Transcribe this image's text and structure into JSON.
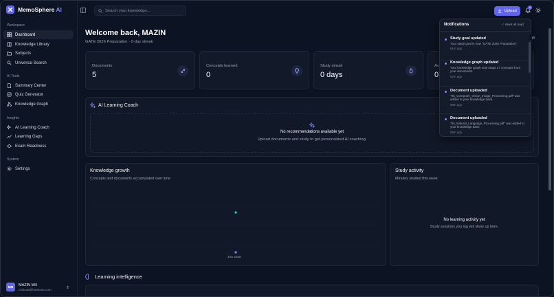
{
  "brand": {
    "name": "MemoSphere",
    "suffix": "AI"
  },
  "sidebar": {
    "sections": [
      {
        "title": "Workspace",
        "items": [
          {
            "label": "Dashboard",
            "icon": "grid-icon",
            "active": true
          },
          {
            "label": "Knowledge Library",
            "icon": "book-icon"
          },
          {
            "label": "Subjects",
            "icon": "folder-icon"
          },
          {
            "label": "Universal Search",
            "icon": "search-icon"
          }
        ]
      },
      {
        "title": "AI Tools",
        "items": [
          {
            "label": "Summary Center",
            "icon": "document-icon"
          },
          {
            "label": "Quiz Generator",
            "icon": "quiz-icon"
          },
          {
            "label": "Knowledge Graph",
            "icon": "graph-icon"
          }
        ]
      },
      {
        "title": "Insights",
        "items": [
          {
            "label": "AI Learning Coach",
            "icon": "sparkles-icon"
          },
          {
            "label": "Learning Gaps",
            "icon": "trend-icon"
          },
          {
            "label": "Exam Readiness",
            "icon": "target-icon"
          }
        ]
      },
      {
        "title": "System",
        "items": [
          {
            "label": "Settings",
            "icon": "gear-icon"
          }
        ]
      }
    ],
    "user": {
      "initials": "MM",
      "name": "MAZIN MH",
      "email": "cmbc38@hotmone.com"
    }
  },
  "topbar": {
    "search_placeholder": "Search your knowledge...",
    "upload_label": "Upload",
    "notification_count": "4"
  },
  "main": {
    "welcome": "Welcome back, MAZIN",
    "subtitle": "GATE 2026 Preparation · 0-day streak",
    "stats": [
      {
        "label": "Documents",
        "value": "5",
        "icon": "link-icon"
      },
      {
        "label": "Concepts learned",
        "value": "0",
        "icon": "bulb-icon"
      },
      {
        "label": "Study streak",
        "value": "0 days",
        "icon": "flame-icon"
      },
      {
        "label": "Av",
        "value": "0",
        "icon": "chart-icon"
      }
    ],
    "coach": {
      "title": "AI Learning Coach",
      "empty_title": "No recommendations available yet",
      "empty_sub": "Upload documents and study to get personalized AI coaching."
    },
    "growth": {
      "title": "Knowledge growth",
      "subtitle": "Concepts and documents accumulated over time",
      "x_tick": "Jun 2026"
    },
    "activity": {
      "title": "Study activity",
      "subtitle": "Minutes studied this week",
      "empty_title": "No learning activity yet",
      "empty_sub": "Study sessions you log will show up here."
    },
    "intelligence_title": "Learning intelligence"
  },
  "notifications": {
    "title": "Notifications",
    "mark_all": "Mark all read",
    "peek": "ys",
    "items": [
      {
        "title": "Study goal updated",
        "body": "Your study goal is now \"GATE 2026 Preparation\".",
        "time": "51m ago"
      },
      {
        "title": "Knowledge graph updated",
        "body": "Your knowledge graph now maps 17 concepts from your documents.",
        "time": "57m ago"
      },
      {
        "title": "Document uploaded",
        "body": "\"05_Computer_Vision_Image_Processing.pdf\" was added to your knowledge base.",
        "time": "58m ago"
      },
      {
        "title": "Document uploaded",
        "body": "\"04_Natural_Language_Processing.pdf\" was added to your knowledge base.",
        "time": "58m ago"
      }
    ]
  },
  "colors": {
    "accent": "#6366f1",
    "bg": "#0c1322",
    "card": "#121a2a",
    "teal": "#2dd4bf"
  }
}
